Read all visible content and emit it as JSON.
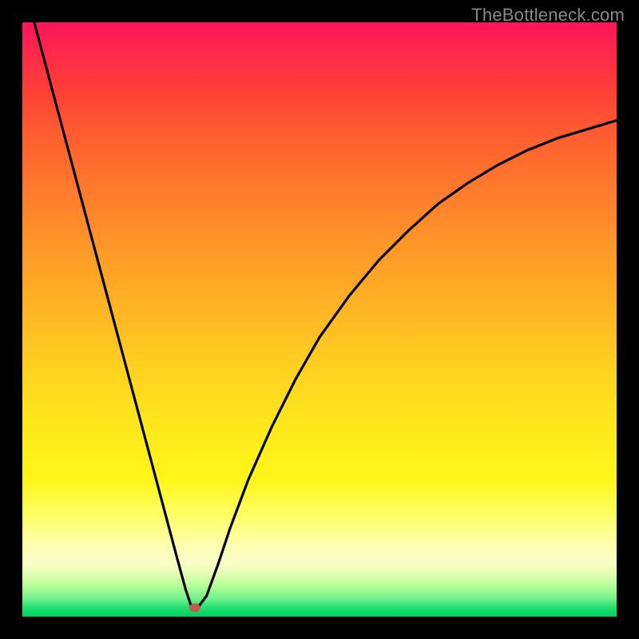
{
  "watermark": "TheBottleneck.com",
  "chart_data": {
    "type": "line",
    "title": "",
    "xlabel": "",
    "ylabel": "",
    "xlim": [
      0,
      100
    ],
    "ylim": [
      0,
      100
    ],
    "series": [
      {
        "name": "bottleneck-curve",
        "x": [
          2,
          4,
          6,
          8,
          10,
          12,
          14,
          16,
          18,
          20,
          22,
          24,
          26,
          27.5,
          28.5,
          29.5,
          31,
          33,
          35,
          38,
          42,
          46,
          50,
          55,
          60,
          65,
          70,
          75,
          80,
          85,
          90,
          95,
          100
        ],
        "values": [
          100,
          92.5,
          85,
          77.5,
          70,
          62.5,
          55,
          47.5,
          40,
          32.5,
          25,
          17.5,
          10,
          4.5,
          1.5,
          1.5,
          3.5,
          9,
          15,
          23,
          32,
          40,
          47,
          54,
          60,
          65,
          69.5,
          73,
          76,
          78.5,
          80.5,
          82,
          83.5
        ]
      }
    ],
    "marker": {
      "x": 29,
      "y": 1.5,
      "color": "#c05a50"
    }
  }
}
